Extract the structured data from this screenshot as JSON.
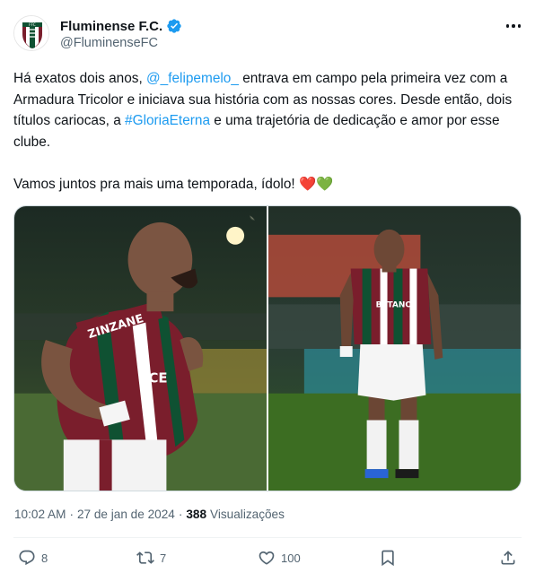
{
  "author": {
    "name": "Fluminense F.C.",
    "handle": "@FluminenseFC",
    "verified": true
  },
  "tweet": {
    "line1_a": "Há exatos dois anos, ",
    "mention": "@_felipemelo_",
    "line1_b": " entrava em campo pela primeira vez com a Armadura Tricolor e iniciava sua história com as nossas cores. Desde então, dois títulos cariocas, a ",
    "hashtag": "#GloriaEterna",
    "line1_c": " e uma trajetória de dedicação e amor por esse clube.",
    "line2": "Vamos juntos pra mais uma temporada, ídolo! ",
    "emojis": "❤️💚"
  },
  "meta": {
    "time": "10:02 AM",
    "separator1": "·",
    "date": "27 de jan de 2024",
    "separator2": "·",
    "views_count": "388",
    "views_label": "Visualizações"
  },
  "actions": {
    "replies": "8",
    "retweets": "7",
    "likes": "100"
  },
  "colors": {
    "link": "#1d9bf0",
    "text": "#0f1419",
    "muted": "#536471",
    "verified": "#1d9bf0",
    "shirt_maroon": "#7a1e2c",
    "shirt_green": "#0f5132"
  },
  "icons": [
    "verified-badge-icon",
    "more-icon",
    "reply-icon",
    "retweet-icon",
    "like-icon",
    "bookmark-icon",
    "share-icon"
  ]
}
